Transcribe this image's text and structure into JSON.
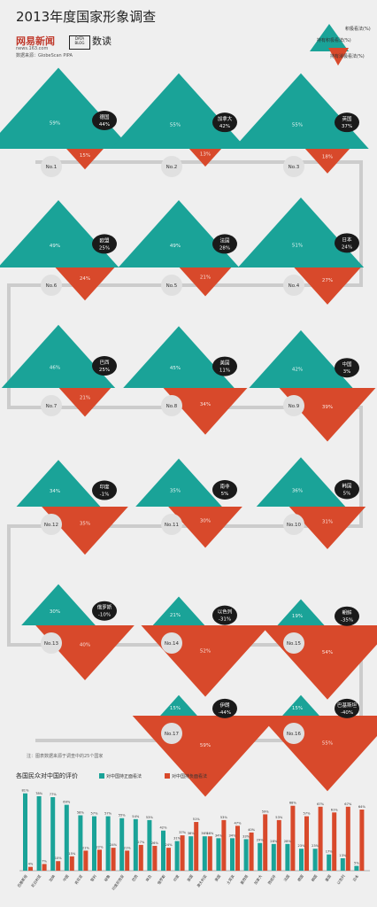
{
  "header": {
    "title": "2013年度国家形象调查",
    "logo": "网易新闻",
    "logo_url": "news.163.com",
    "data_box": "DATA BLOG",
    "data_label": "数读",
    "source": "数据来源：GlobeScan PIPA"
  },
  "legend": {
    "positive": "持有积极看法(%)",
    "positive_short": "积极看法(%)",
    "negative": "持有消极看法(%)"
  },
  "colors": {
    "positive": "#1aa398",
    "negative": "#d8492b",
    "map": "#1a1a1a",
    "line": "#cccccc"
  },
  "footnote": "注：图表数据来源于调查中的25个国家",
  "chart_data": [
    {
      "type": "triangle-pairs",
      "items": [
        {
          "rank": "No.1",
          "country": "德国",
          "net": "44%",
          "positive": 59,
          "negative": 15
        },
        {
          "rank": "No.2",
          "country": "加拿大",
          "net": "42%",
          "positive": 55,
          "negative": 13
        },
        {
          "rank": "No.3",
          "country": "英国",
          "net": "37%",
          "positive": 55,
          "negative": 18
        },
        {
          "rank": "No.4",
          "country": "日本",
          "net": "24%",
          "positive": 51,
          "negative": 27
        },
        {
          "rank": "No.5",
          "country": "法国",
          "net": "28%",
          "positive": 49,
          "negative": 21
        },
        {
          "rank": "No.6",
          "country": "欧盟",
          "net": "25%",
          "positive": 49,
          "negative": 24
        },
        {
          "rank": "No.7",
          "country": "巴西",
          "net": "25%",
          "positive": 46,
          "negative": 21
        },
        {
          "rank": "No.8",
          "country": "美国",
          "net": "11%",
          "positive": 45,
          "negative": 34
        },
        {
          "rank": "No.9",
          "country": "中国",
          "net": "3%",
          "positive": 42,
          "negative": 39
        },
        {
          "rank": "No.10",
          "country": "韩国",
          "net": "5%",
          "positive": 36,
          "negative": 31
        },
        {
          "rank": "No.11",
          "country": "南非",
          "net": "5%",
          "positive": 35,
          "negative": 30
        },
        {
          "rank": "No.12",
          "country": "印度",
          "net": "-1%",
          "positive": 34,
          "negative": 35
        },
        {
          "rank": "No.13",
          "country": "俄罗斯",
          "net": "-10%",
          "positive": 30,
          "negative": 40
        },
        {
          "rank": "No.14",
          "country": "以色列",
          "net": "-31%",
          "positive": 21,
          "negative": 52
        },
        {
          "rank": "No.15",
          "country": "朝鲜",
          "net": "-35%",
          "positive": 19,
          "negative": 54
        },
        {
          "rank": "No.16",
          "country": "巴基斯坦",
          "net": "-40%",
          "positive": 15,
          "negative": 55
        },
        {
          "rank": "No.17",
          "country": "伊朗",
          "net": "-44%",
          "positive": 15,
          "negative": 59
        }
      ]
    },
    {
      "type": "bar",
      "title": "各国民众对中国的评价",
      "categories": [
        "巴基斯坦",
        "尼日利亚",
        "加纳",
        "中国",
        "肯尼亚",
        "智利",
        "秘鲁",
        "印度尼西亚",
        "巴西",
        "埃及",
        "俄罗斯",
        "印度",
        "英国",
        "澳大利亚",
        "美国",
        "土耳其",
        "墨西哥",
        "加拿大",
        "西班牙",
        "法国",
        "德国",
        "韩国",
        "墨国",
        "以色列",
        "日本"
      ],
      "series": [
        {
          "name": "对中国持正面看法",
          "values": [
            81,
            78,
            77,
            69,
            58,
            57,
            57,
            55,
            54,
            53,
            42,
            31,
            36,
            36,
            34,
            34,
            33,
            29,
            28,
            28,
            23,
            23,
            17,
            13,
            5
          ]
        },
        {
          "name": "对中国持负面看法",
          "values": [
            4,
            7,
            10,
            15,
            21,
            22,
            24,
            21,
            27,
            26,
            24,
            37,
            51,
            36,
            53,
            47,
            40,
            59,
            53,
            68,
            57,
            67,
            61,
            67,
            64
          ]
        }
      ],
      "ylim": [
        0,
        90
      ]
    }
  ]
}
